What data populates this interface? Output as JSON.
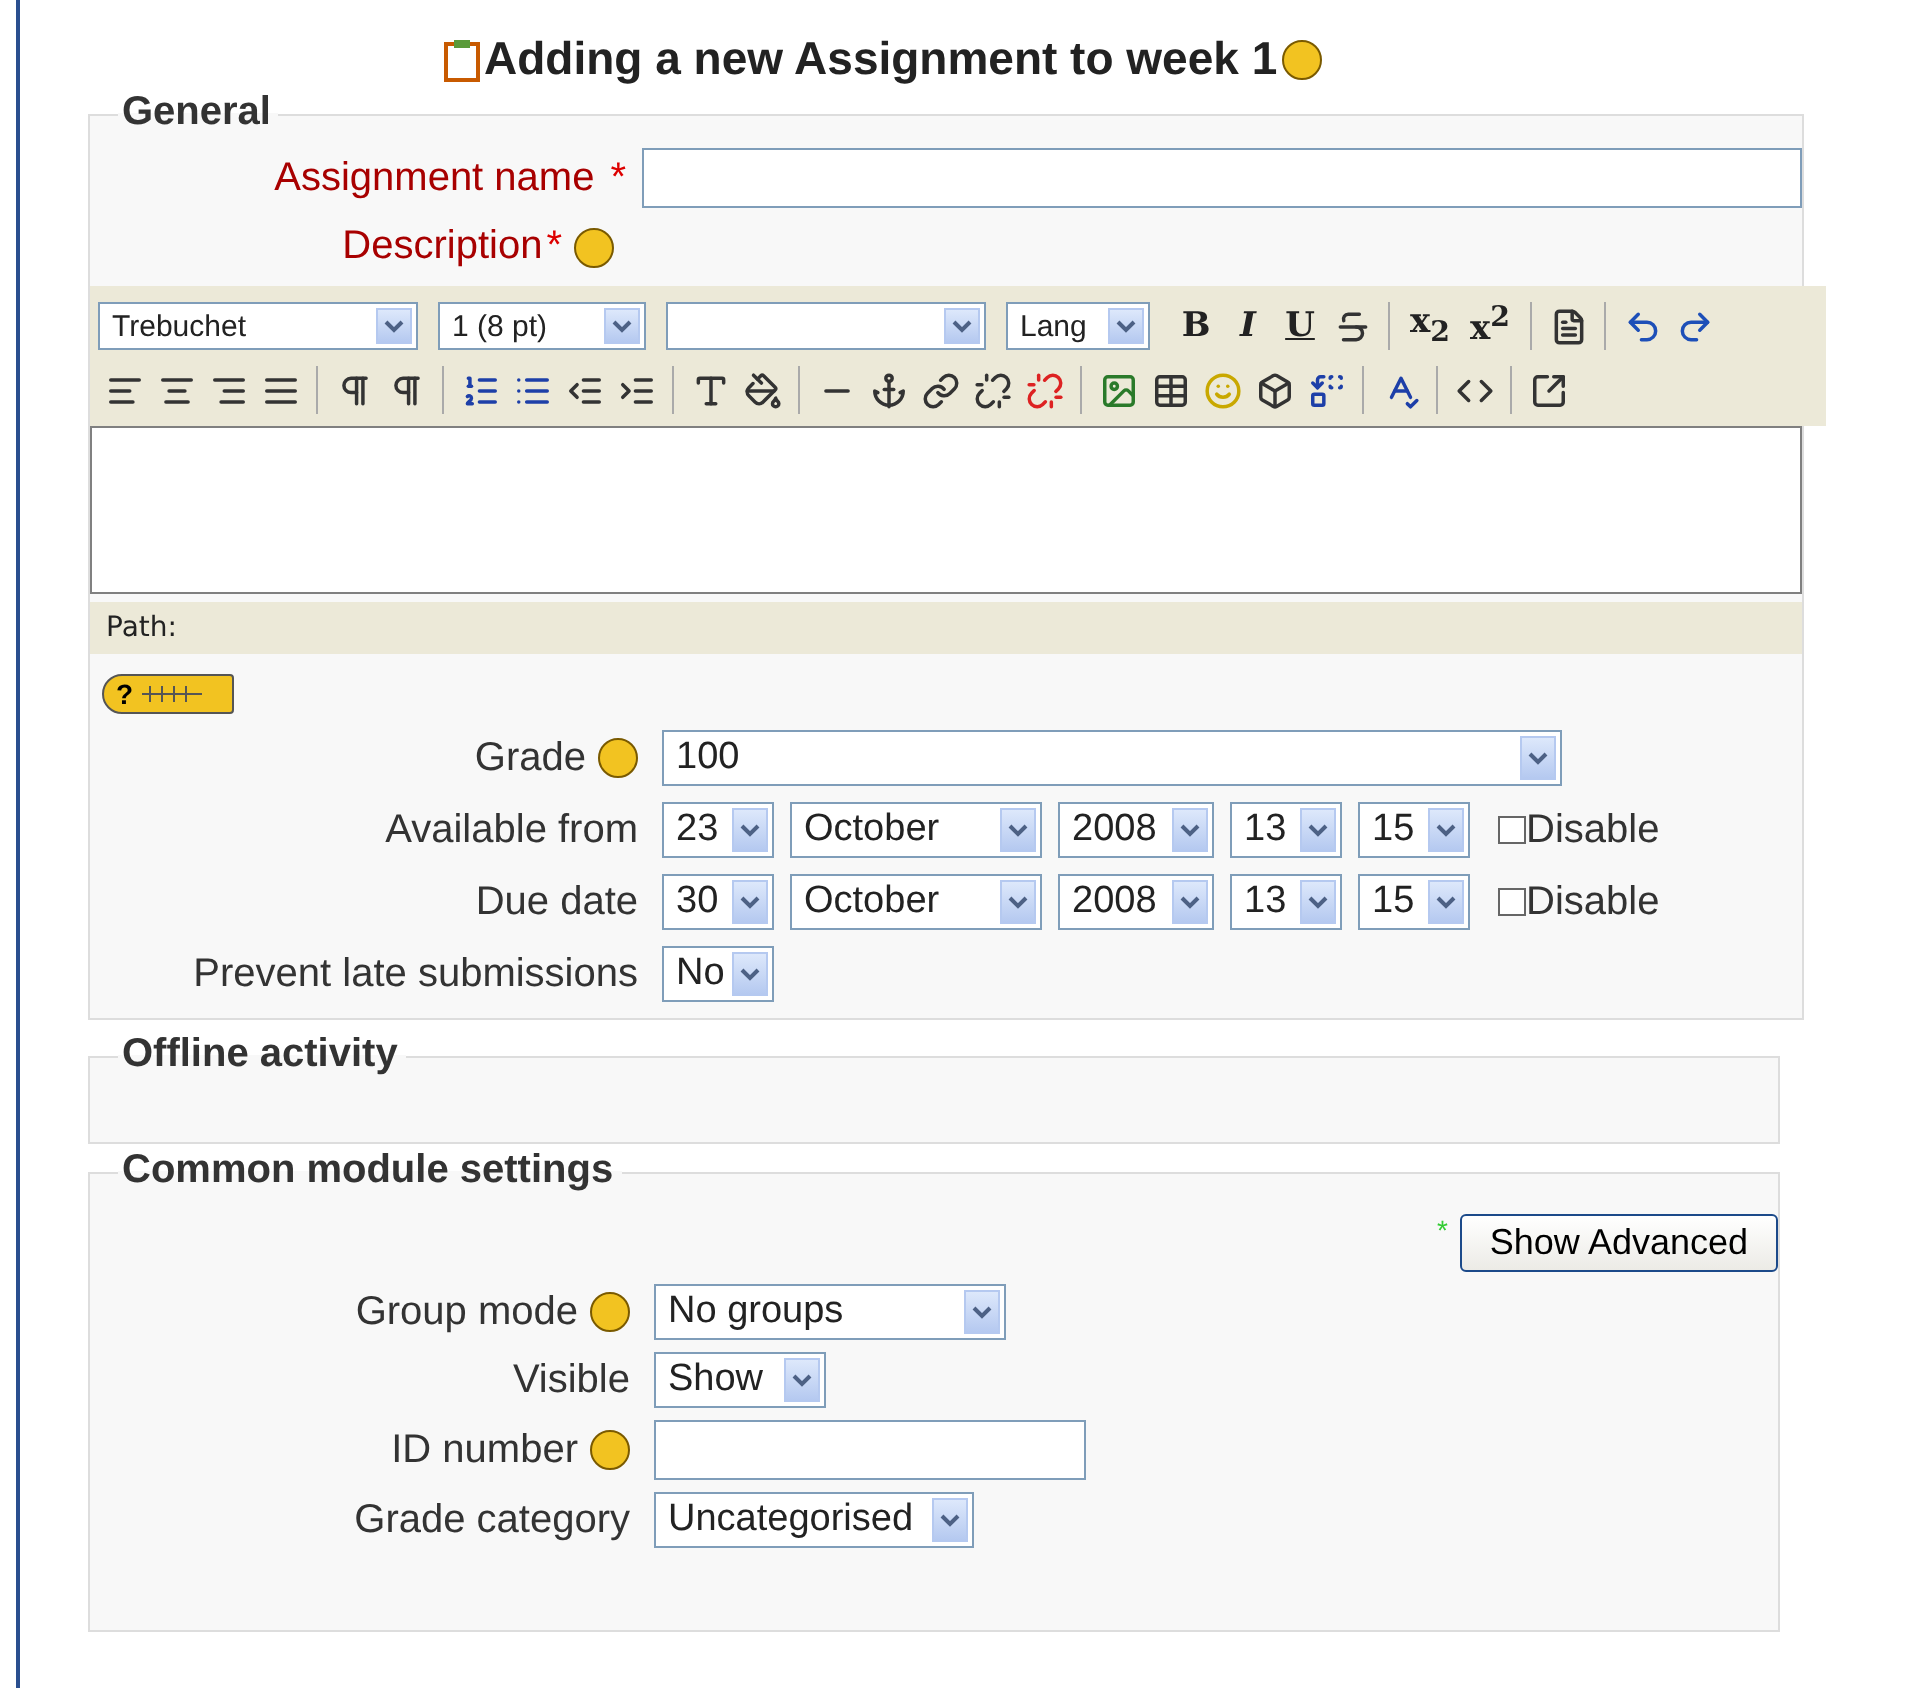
{
  "title": "Adding a new Assignment to week 1",
  "general": {
    "legend": "General",
    "name_field": {
      "label": "Assignment name",
      "required_mark": "*"
    },
    "description": {
      "label": "Description",
      "required_mark": "*"
    },
    "editor": {
      "selects": [
        {
          "kind": "dropdown",
          "value": "Trebuchet"
        },
        {
          "kind": "dropdown",
          "value": "1 (8 pt)"
        },
        {
          "kind": "dropdown"
        },
        {
          "kind": "dropdown",
          "value": "Lang"
        }
      ],
      "row1": [
        [
          {
            "kind": "bold",
            "label": "B"
          },
          {
            "kind": "italic",
            "label": "I"
          },
          {
            "kind": "underline",
            "label": "U"
          },
          {
            "kind": "strike"
          }
        ],
        [
          {
            "kind": "sub",
            "label": "x$_{2}$"
          },
          {
            "kind": "sup",
            "label": "x$^{2}$"
          }
        ],
        [
          {
            "kind": "word"
          }
        ],
        [
          {
            "kind": "undo"
          },
          {
            "kind": "redo"
          }
        ]
      ],
      "row2": [
        [
          {
            "kind": "align-left"
          },
          {
            "kind": "align-center"
          },
          {
            "kind": "align-right"
          },
          {
            "kind": "justify"
          }
        ],
        [
          {
            "kind": "ltr"
          },
          {
            "kind": "rtl"
          }
        ],
        [
          {
            "kind": "ol"
          },
          {
            "kind": "ul"
          },
          {
            "kind": "outdent"
          },
          {
            "kind": "indent"
          }
        ],
        [
          {
            "kind": "text-color"
          },
          {
            "kind": "bg-color"
          }
        ],
        [
          {
            "kind": "rule"
          },
          {
            "kind": "anchor"
          },
          {
            "kind": "link"
          },
          {
            "kind": "unlink"
          },
          {
            "kind": "nolink"
          }
        ],
        [
          {
            "kind": "image"
          },
          {
            "kind": "table"
          },
          {
            "kind": "smiley"
          },
          {
            "kind": "cube"
          },
          {
            "kind": "replace"
          }
        ],
        [
          {
            "kind": "spell"
          }
        ],
        [
          {
            "kind": "code"
          }
        ],
        [
          {
            "kind": "fullscreen"
          }
        ]
      ],
      "path_label": "Path:"
    },
    "keyboard_help": {
      "label": "?"
    },
    "rows": [
      {
        "label": "Grade",
        "help": true,
        "kind": "wide",
        "selects": [
          {
            "value": "100"
          }
        ]
      },
      {
        "label": "Available from",
        "help": false,
        "kind": "date",
        "selects": [
          {
            "value": "23"
          },
          {
            "value": "October"
          },
          {
            "value": "2008"
          },
          {
            "value": "13"
          },
          {
            "value": "15"
          }
        ],
        "disable": {
          "label": "Disable",
          "checked": false
        }
      },
      {
        "label": "Due date",
        "help": false,
        "kind": "date",
        "selects": [
          {
            "value": "30"
          },
          {
            "value": "October"
          },
          {
            "value": "2008"
          },
          {
            "value": "13"
          },
          {
            "value": "15"
          }
        ],
        "disable": {
          "label": "Disable",
          "checked": false
        }
      },
      {
        "label": "Prevent late submissions",
        "help": false,
        "kind": "short",
        "selects": [
          {
            "value": "No"
          }
        ]
      }
    ]
  },
  "offline": {
    "legend": "Offline activity"
  },
  "common": {
    "legend": "Common module settings",
    "advanced_mark": "*",
    "advanced_button": "Show Advanced",
    "rows": [
      {
        "label": "Group mode",
        "help": true,
        "kind": "select",
        "value": "No groups"
      },
      {
        "label": "Visible",
        "help": false,
        "kind": "select",
        "value": "Show"
      },
      {
        "label": "ID number",
        "help": true,
        "kind": "input"
      },
      {
        "label": "Grade category",
        "help": false,
        "kind": "select",
        "value": "Uncategorised"
      }
    ]
  }
}
